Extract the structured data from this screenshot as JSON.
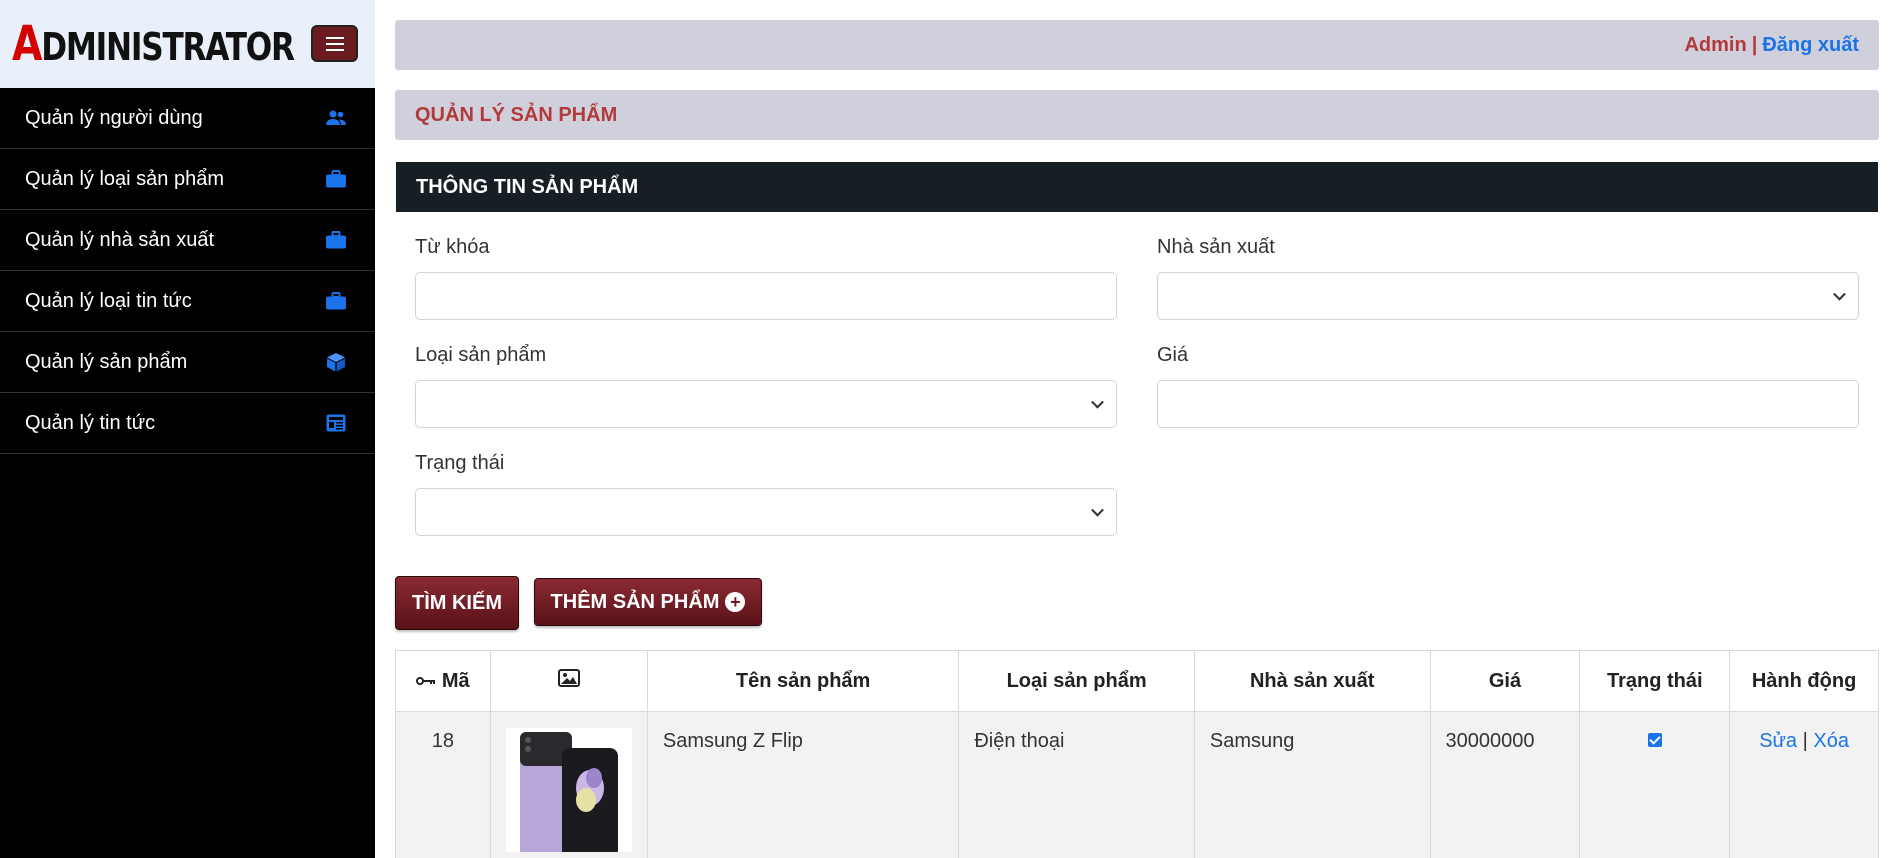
{
  "brand": {
    "logo_first": "A",
    "logo_rest": "DMINISTRATOR"
  },
  "sidebar": {
    "items": [
      {
        "label": "Quản lý người dùng",
        "icon": "users-icon"
      },
      {
        "label": "Quản lý loại sản phẩm",
        "icon": "briefcase-icon"
      },
      {
        "label": "Quản lý nhà sản xuất",
        "icon": "briefcase-icon"
      },
      {
        "label": "Quản lý loại tin tức",
        "icon": "briefcase-icon"
      },
      {
        "label": "Quản lý sản phẩm",
        "icon": "box-icon"
      },
      {
        "label": "Quản lý tin tức",
        "icon": "newspaper-icon"
      }
    ]
  },
  "header": {
    "user": "Admin",
    "separator": "|",
    "logout": "Đăng xuất"
  },
  "page": {
    "title": "QUẢN LÝ SẢN PHẨM"
  },
  "form": {
    "header": "THÔNG TIN SẢN PHẨM",
    "keyword_label": "Từ khóa",
    "keyword_value": "",
    "manufacturer_label": "Nhà sản xuất",
    "manufacturer_value": "",
    "category_label": "Loại sản phẩm",
    "category_value": "",
    "price_label": "Giá",
    "price_value": "",
    "status_label": "Trạng thái",
    "status_value": ""
  },
  "buttons": {
    "search": "TÌM KIẾM",
    "add": "THÊM SẢN PHẨM"
  },
  "table": {
    "headers": {
      "id": "Mã",
      "name": "Tên sản phẩm",
      "category": "Loại sản phẩm",
      "manufacturer": "Nhà sản xuất",
      "price": "Giá",
      "status": "Trạng thái",
      "action": "Hành động"
    },
    "rows": [
      {
        "id": "18",
        "name": "Samsung Z Flip",
        "category": "Điện thoại",
        "manufacturer": "Samsung",
        "price": "30000000",
        "status": true,
        "edit": "Sửa",
        "sep": "|",
        "delete": "Xóa"
      }
    ]
  },
  "colors": {
    "sidebar_bg": "#000000",
    "accent_red": "#b33a3a",
    "link_blue": "#1a73e8",
    "button_bg": "#6a1b20",
    "card_header_bg": "#162024"
  }
}
